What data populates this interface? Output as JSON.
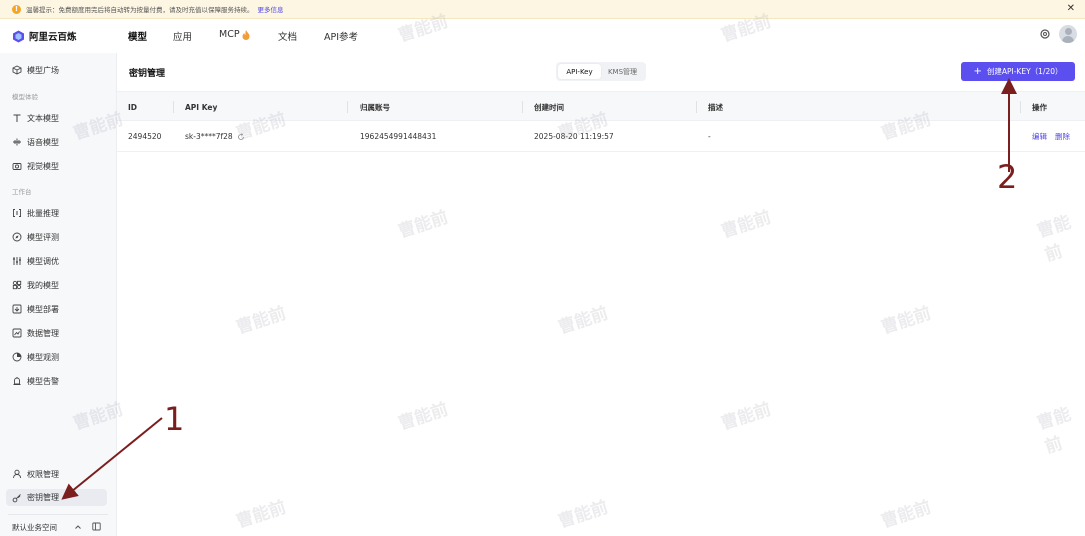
{
  "notice": {
    "text": "温馨提示：免费额度用完后将自动转为按量付费，请及时充值以保障服务持续。",
    "link": "更多信息"
  },
  "header": {
    "logo_text": "阿里云百炼",
    "nav": [
      "模型",
      "应用",
      "MCP",
      "文档",
      "API参考"
    ]
  },
  "sidebar": {
    "top_item": "模型广场",
    "group1": "模型体验",
    "group1_items": [
      "文本模型",
      "语音模型",
      "视觉模型"
    ],
    "group2": "工作台",
    "group2_items": [
      "批量推理",
      "模型评测",
      "模型调优",
      "我的模型",
      "模型部署",
      "数据管理",
      "模型观测",
      "模型告警"
    ],
    "bottom_items": [
      "权限管理",
      "密钥管理"
    ],
    "workspace": "默认业务空间"
  },
  "main": {
    "title": "密钥管理",
    "tabs": [
      "API-Key",
      "KMS管理"
    ],
    "create_button": "创建API-KEY（1/20）",
    "columns": [
      "ID",
      "API Key",
      "归属账号",
      "创建时间",
      "描述",
      "操作"
    ],
    "rows": [
      {
        "id": "2494520",
        "api_key": "sk-3****7f28",
        "account": "1962454991448431",
        "created": "2025-08-20 11:19:57",
        "desc": "-",
        "ops": [
          "编辑",
          "删除"
        ]
      }
    ]
  },
  "annotations": [
    "1",
    "2"
  ],
  "watermark": "曹能前",
  "colors": {
    "accent": "#5b4ff0",
    "link": "#4f46e5",
    "annotation": "#7a1e1e",
    "notice_bg": "#fdf6e3"
  }
}
